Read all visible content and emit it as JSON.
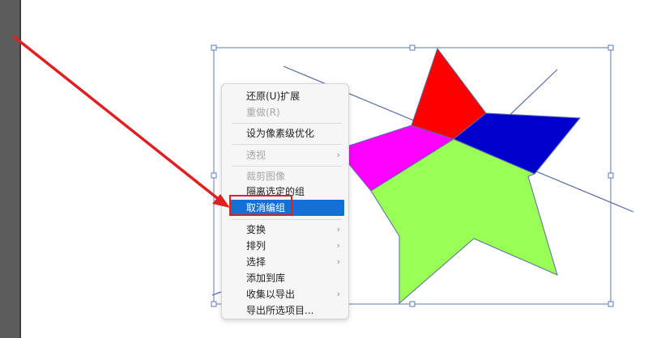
{
  "canvas": {
    "shape_colors": {
      "red": "#ff0000",
      "blue": "#0000cc",
      "magenta": "#ff00ff",
      "lime": "#99ff55",
      "outline": "#5a6aa8",
      "selection": "#5a7ab8",
      "arrow": "#e02020"
    }
  },
  "context_menu": {
    "items": [
      {
        "label": "还原(U)扩展",
        "enabled": true,
        "submenu": false
      },
      {
        "label": "重做(R)",
        "enabled": false,
        "submenu": false
      },
      {
        "label": "设为像素级优化",
        "enabled": true,
        "submenu": false
      },
      {
        "label": "透视",
        "enabled": false,
        "submenu": true
      },
      {
        "label": "裁剪图像",
        "enabled": false,
        "submenu": false
      },
      {
        "label": "隔离选定的组",
        "enabled": true,
        "submenu": false
      },
      {
        "label": "取消编组",
        "enabled": true,
        "submenu": false,
        "highlighted": true
      },
      {
        "label": "变换",
        "enabled": true,
        "submenu": true
      },
      {
        "label": "排列",
        "enabled": true,
        "submenu": true
      },
      {
        "label": "选择",
        "enabled": true,
        "submenu": true
      },
      {
        "label": "添加到库",
        "enabled": true,
        "submenu": false
      },
      {
        "label": "收集以导出",
        "enabled": true,
        "submenu": true
      },
      {
        "label": "导出所选项目...",
        "enabled": true,
        "submenu": false
      }
    ],
    "submenu_glyph": "›"
  }
}
